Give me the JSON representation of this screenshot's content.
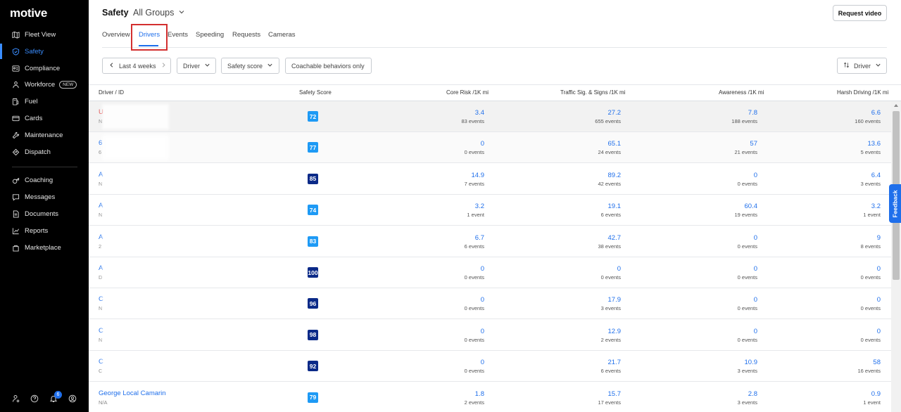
{
  "app": {
    "logo": "motive"
  },
  "sidebar": {
    "items": [
      {
        "label": "Fleet View",
        "icon": "map-icon"
      },
      {
        "label": "Safety",
        "icon": "shield-icon",
        "active": true
      },
      {
        "label": "Compliance",
        "icon": "id-card-icon"
      },
      {
        "label": "Workforce",
        "icon": "person-icon",
        "badge": "NEW"
      },
      {
        "label": "Fuel",
        "icon": "fuel-icon"
      },
      {
        "label": "Cards",
        "icon": "credit-card-icon"
      },
      {
        "label": "Maintenance",
        "icon": "wrench-icon"
      },
      {
        "label": "Dispatch",
        "icon": "route-icon"
      },
      {
        "label": "Coaching",
        "icon": "whistle-icon"
      },
      {
        "label": "Messages",
        "icon": "chat-icon"
      },
      {
        "label": "Documents",
        "icon": "document-icon"
      },
      {
        "label": "Reports",
        "icon": "chart-icon"
      },
      {
        "label": "Marketplace",
        "icon": "bag-icon"
      }
    ],
    "notification_count": "6"
  },
  "header": {
    "title": "Safety",
    "group": "All Groups",
    "request_button": "Request video"
  },
  "tabs": [
    "Overview",
    "Drivers",
    "Events",
    "Speeding",
    "Requests",
    "Cameras"
  ],
  "active_tab": "Drivers",
  "filters": {
    "date_range": "Last 4 weeks",
    "driver": "Driver",
    "safety_score": "Safety score",
    "coachable": "Coachable behaviors only",
    "sort": "Driver"
  },
  "table": {
    "columns": [
      "Driver / ID",
      "Safety Score",
      "Core Risk /1K mi",
      "Traffic Sig. & Signs /1K mi",
      "Awareness /1K mi",
      "Harsh Driving /1K mi"
    ],
    "rows": [
      {
        "name": "U",
        "id": "N",
        "score": "72",
        "core": [
          "3.4",
          "83 events"
        ],
        "traffic": [
          "27.2",
          "655 events"
        ],
        "awareness": [
          "7.8",
          "188 events"
        ],
        "harsh": [
          "6.6",
          "160 events"
        ]
      },
      {
        "name": "6",
        "id": "6",
        "score": "77",
        "core": [
          "0",
          "0 events"
        ],
        "traffic": [
          "65.1",
          "24 events"
        ],
        "awareness": [
          "57",
          "21 events"
        ],
        "harsh": [
          "13.6",
          "5 events"
        ]
      },
      {
        "name": "A",
        "id": "N",
        "score": "85",
        "core": [
          "14.9",
          "7 events"
        ],
        "traffic": [
          "89.2",
          "42 events"
        ],
        "awareness": [
          "0",
          "0 events"
        ],
        "harsh": [
          "6.4",
          "3 events"
        ]
      },
      {
        "name": "A",
        "id": "N",
        "score": "74",
        "core": [
          "3.2",
          "1 event"
        ],
        "traffic": [
          "19.1",
          "6 events"
        ],
        "awareness": [
          "60.4",
          "19 events"
        ],
        "harsh": [
          "3.2",
          "1 event"
        ]
      },
      {
        "name": "A",
        "id": "2",
        "score": "83",
        "core": [
          "6.7",
          "6 events"
        ],
        "traffic": [
          "42.7",
          "38 events"
        ],
        "awareness": [
          "0",
          "0 events"
        ],
        "harsh": [
          "9",
          "8 events"
        ]
      },
      {
        "name": "A",
        "id": "D",
        "score": "100",
        "core": [
          "0",
          "0 events"
        ],
        "traffic": [
          "0",
          "0 events"
        ],
        "awareness": [
          "0",
          "0 events"
        ],
        "harsh": [
          "0",
          "0 events"
        ]
      },
      {
        "name": "C",
        "id": "N",
        "score": "96",
        "core": [
          "0",
          "0 events"
        ],
        "traffic": [
          "17.9",
          "3 events"
        ],
        "awareness": [
          "0",
          "0 events"
        ],
        "harsh": [
          "0",
          "0 events"
        ]
      },
      {
        "name": "C",
        "id": "N",
        "score": "98",
        "core": [
          "0",
          "0 events"
        ],
        "traffic": [
          "12.9",
          "2 events"
        ],
        "awareness": [
          "0",
          "0 events"
        ],
        "harsh": [
          "0",
          "0 events"
        ]
      },
      {
        "name": "C",
        "id": "C",
        "score": "92",
        "core": [
          "0",
          "0 events"
        ],
        "traffic": [
          "21.7",
          "6 events"
        ],
        "awareness": [
          "10.9",
          "3 events"
        ],
        "harsh": [
          "58",
          "16 events"
        ]
      },
      {
        "name": "George Local Camarin",
        "id": "N/A",
        "score": "79",
        "core": [
          "1.8",
          "2 events"
        ],
        "traffic": [
          "15.7",
          "17 events"
        ],
        "awareness": [
          "2.8",
          "3 events"
        ],
        "harsh": [
          "0.9",
          "1 event"
        ]
      }
    ]
  },
  "feedback_label": "Feedback",
  "colors": {
    "accent": "#1f6feb",
    "score_light": "#1e9af5",
    "score_dark": "#0b2a88",
    "highlight": "#d32f2f"
  }
}
